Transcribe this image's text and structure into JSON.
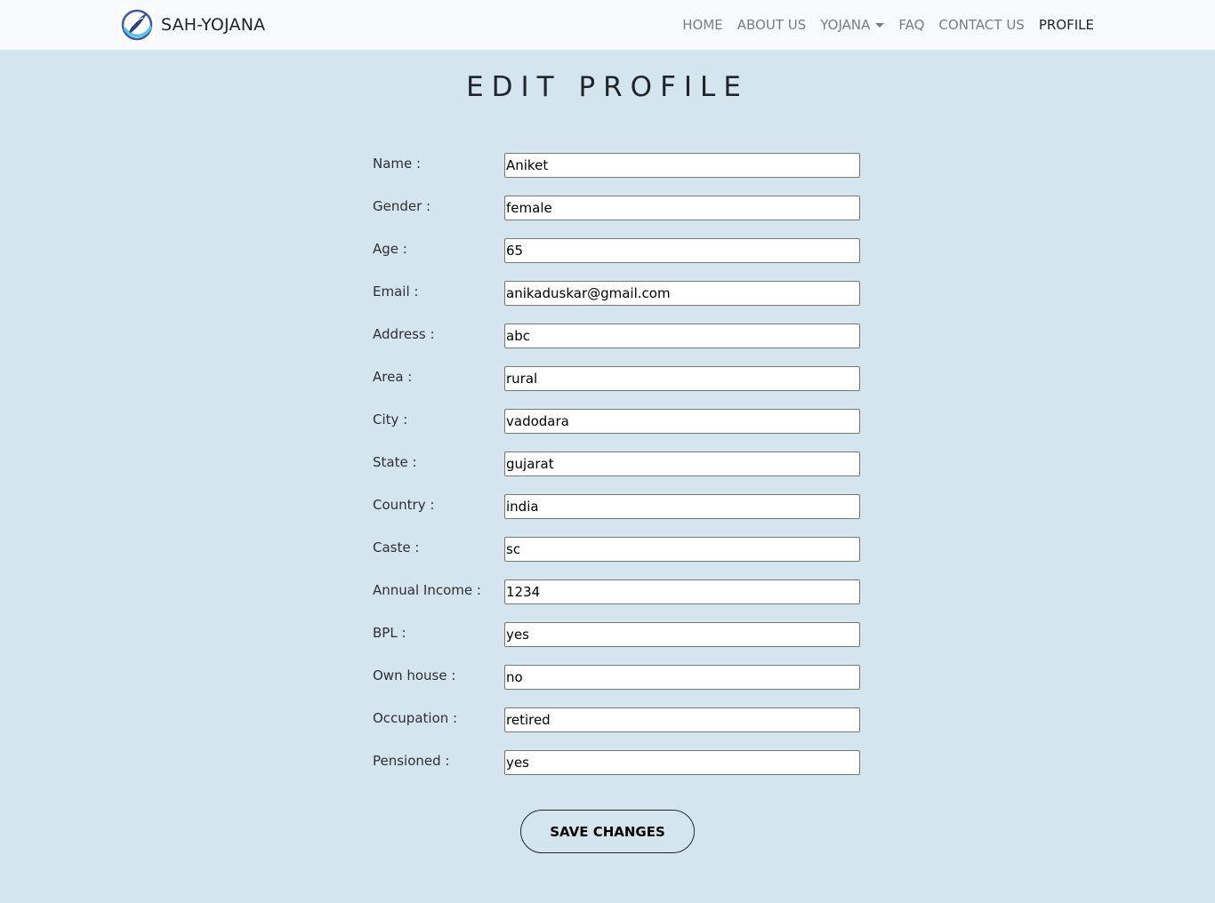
{
  "navbar": {
    "brand": "SAH-YOJANA",
    "logo_icon": "sah-yojana-logo-icon",
    "links": [
      {
        "label": "HOME",
        "active": false
      },
      {
        "label": "ABOUT US",
        "active": false
      },
      {
        "label": "YOJANA",
        "active": false,
        "dropdown": true
      },
      {
        "label": "FAQ",
        "active": false
      },
      {
        "label": "CONTACT US",
        "active": false
      },
      {
        "label": "PROFILE",
        "active": true
      }
    ]
  },
  "page": {
    "title": "EDIT PROFILE"
  },
  "form": {
    "fields": [
      {
        "label": "Name :",
        "value": "Aniket"
      },
      {
        "label": "Gender :",
        "value": "female"
      },
      {
        "label": "Age :",
        "value": "65"
      },
      {
        "label": "Email :",
        "value": "anikaduskar@gmail.com"
      },
      {
        "label": "Address :",
        "value": "abc"
      },
      {
        "label": "Area :",
        "value": "rural"
      },
      {
        "label": "City :",
        "value": "vadodara"
      },
      {
        "label": "State :",
        "value": "gujarat"
      },
      {
        "label": "Country :",
        "value": "india"
      },
      {
        "label": "Caste :",
        "value": "sc"
      },
      {
        "label": "Annual Income :",
        "value": "1234"
      },
      {
        "label": "BPL :",
        "value": "yes"
      },
      {
        "label": "Own house :",
        "value": "no"
      },
      {
        "label": "Occupation :",
        "value": "retired"
      },
      {
        "label": "Pensioned :",
        "value": "yes"
      }
    ],
    "save_label": "SAVE CHANGES"
  },
  "colors": {
    "background": "#d5e5f0",
    "navbar": "#f8f9fa",
    "nav_link": "#7a7d80",
    "nav_link_active": "#212529"
  }
}
